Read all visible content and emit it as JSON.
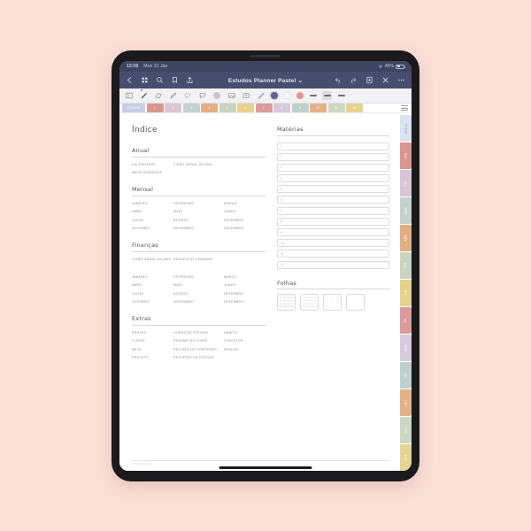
{
  "device": {
    "status_bar": {
      "time": "13:08",
      "date": "Mon 31 Jan",
      "battery_percent": "45%",
      "wifi_icon": "wifi-icon"
    }
  },
  "app": {
    "title_bar": {
      "document_title": "Estudos Planner Pastel",
      "back_icon": "back-chevron-icon",
      "thumbnails_icon": "grid-thumbnails-icon",
      "search_icon": "search-icon",
      "bookmark_icon": "bookmark-icon",
      "share_icon": "share-icon",
      "undo_icon": "undo-icon",
      "redo_icon": "redo-icon",
      "add_page_icon": "add-page-icon",
      "close_icon": "close-icon",
      "more_icon": "more-options-icon"
    },
    "toolbar": {
      "tools": [
        {
          "name": "reader-view-icon",
          "active": false
        },
        {
          "name": "pen-icon",
          "active": true
        },
        {
          "name": "eraser-icon",
          "active": false
        },
        {
          "name": "highlighter-icon",
          "active": false
        },
        {
          "name": "lasso-select-icon",
          "active": false
        },
        {
          "name": "shape-icon",
          "active": false
        },
        {
          "name": "sticker-icon",
          "active": false
        },
        {
          "name": "image-icon",
          "active": false
        },
        {
          "name": "text-box-icon",
          "active": false
        },
        {
          "name": "ruler-icon",
          "active": false
        }
      ],
      "colors": [
        {
          "name": "color-swatch-navy",
          "hex": "#5b6492",
          "selected": true
        },
        {
          "name": "color-swatch-white",
          "hex": "#ffffff",
          "selected": false
        },
        {
          "name": "color-swatch-salmon",
          "hex": "#e8928c",
          "selected": false
        }
      ],
      "thickness": [
        {
          "name": "stroke-thin",
          "selected": false
        },
        {
          "name": "stroke-medium",
          "selected": true
        },
        {
          "name": "stroke-thick",
          "selected": false
        }
      ]
    },
    "page_tabs": {
      "label": "FOLHAS",
      "tabs": [
        {
          "label": "1",
          "hex": "#d9958e"
        },
        {
          "label": "2",
          "hex": "#d8c6d4"
        },
        {
          "label": "3",
          "hex": "#c3d2cc"
        },
        {
          "label": "4",
          "hex": "#e2ae82"
        },
        {
          "label": "5",
          "hex": "#c9d4c0"
        },
        {
          "label": "6",
          "hex": "#e6d28a"
        },
        {
          "label": "7",
          "hex": "#dd9a9a"
        },
        {
          "label": "8",
          "hex": "#d6cadd"
        },
        {
          "label": "9",
          "hex": "#bdd0cc"
        },
        {
          "label": "10",
          "hex": "#e3b188"
        },
        {
          "label": "11",
          "hex": "#ccd8c3"
        },
        {
          "label": "12",
          "hex": "#e7d391"
        }
      ],
      "menu_icon": "hamburger-menu-icon"
    }
  },
  "document": {
    "page_title": "Índice",
    "sections": [
      {
        "heading": "Anual",
        "rows": [
          [
            "CALENDÁRIO",
            "VISÃO GERAL DO ANO",
            ""
          ],
          [
            "MEUS HORÁRIOS",
            "",
            ""
          ]
        ]
      },
      {
        "heading": "Mensal",
        "rows": [
          [
            "JANEIRO",
            "FEVEREIRO",
            "MARÇO"
          ],
          [
            "ABRIL",
            "MAIO",
            "JUNHO"
          ],
          [
            "JULHO",
            "AGOSTO",
            "SETEMBRO"
          ],
          [
            "OUTUBRO",
            "NOVEMBRO",
            "DEZEMBRO"
          ]
        ]
      },
      {
        "heading": "Finanças",
        "rows": [
          [
            "VISÃO GERAL DO ANO",
            "DESAFIO 52 SEMANAS",
            ""
          ],
          [
            "",
            "",
            ""
          ],
          [
            "JANEIRO",
            "FEVEREIRO",
            "MARÇO"
          ],
          [
            "ABRIL",
            "MAIO",
            "JUNHO"
          ],
          [
            "JULHO",
            "AGOSTO",
            "SETEMBRO"
          ],
          [
            "OUTUBRO",
            "NOVEMBRO",
            "DEZEMBRO"
          ]
        ]
      },
      {
        "heading": "Extras",
        "rows": [
          [
            "PROVAS",
            "HORAS DE ESTUDO",
            "HÁBITO"
          ],
          [
            "LIVROS",
            "RESUMO DO LIVRO",
            "CONTATOS"
          ],
          [
            "META",
            "REVISÃO DE CONTEÚDO",
            "SENHAS"
          ],
          [
            "PROJETO",
            "REGISTRO DE ESTUDO",
            ""
          ]
        ]
      }
    ],
    "materias": {
      "heading": "Matérias",
      "fields": [
        {
          "number": "1",
          "value": ""
        },
        {
          "number": "2",
          "value": ""
        },
        {
          "number": "3",
          "value": ""
        },
        {
          "number": "4",
          "value": ""
        },
        {
          "number": "5",
          "value": ""
        },
        {
          "number": "6",
          "value": ""
        },
        {
          "number": "7",
          "value": ""
        },
        {
          "number": "8",
          "value": ""
        },
        {
          "number": "9",
          "value": ""
        },
        {
          "number": "10",
          "value": ""
        },
        {
          "number": "11",
          "value": ""
        },
        {
          "number": "12",
          "value": ""
        }
      ]
    },
    "folhas": {
      "heading": "Folhas",
      "sheets": [
        {
          "name": "grid-paper-icon"
        },
        {
          "name": "lined-paper-icon"
        },
        {
          "name": "dotted-paper-icon"
        },
        {
          "name": "blank-paper-icon"
        }
      ]
    },
    "footer_credit": "© Pastel Design"
  },
  "side_tabs": [
    {
      "label": "ANUAL",
      "hex": "#dbe2f2",
      "first": true
    },
    {
      "label": "JAN",
      "hex": "#d9958e"
    },
    {
      "label": "FEV",
      "hex": "#d8c6d4"
    },
    {
      "label": "MAR",
      "hex": "#c3d2cc"
    },
    {
      "label": "ABR",
      "hex": "#e2ae82"
    },
    {
      "label": "MAI",
      "hex": "#c9d4c0"
    },
    {
      "label": "JUN",
      "hex": "#e6d28a"
    },
    {
      "label": "JUL",
      "hex": "#dd9a9a"
    },
    {
      "label": "AGO",
      "hex": "#d6cadd"
    },
    {
      "label": "SET",
      "hex": "#bdd0cc"
    },
    {
      "label": "OUT",
      "hex": "#e3b188"
    },
    {
      "label": "NOV",
      "hex": "#ccd8c3"
    },
    {
      "label": "DEZ",
      "hex": "#e7d391"
    }
  ]
}
